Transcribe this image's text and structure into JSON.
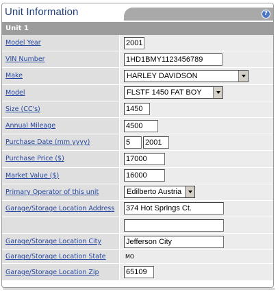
{
  "header": {
    "title": "Unit Information",
    "help_icon": "?"
  },
  "unit": {
    "label": "Unit 1"
  },
  "fields": {
    "model_year": {
      "label": "Model Year",
      "value": "2001"
    },
    "vin": {
      "label": "VIN Number",
      "value": "1HD1BMY1123456789"
    },
    "make": {
      "label": "Make",
      "value": "HARLEY DAVIDSON"
    },
    "model": {
      "label": "Model",
      "value": "FLSTF 1450 FAT BOY"
    },
    "size": {
      "label": "Size (CC's)",
      "value": "1450"
    },
    "annual_mileage": {
      "label": "Annual Mileage",
      "value": "4500"
    },
    "purchase_date": {
      "label": "Purchase Date (mm yyyy)",
      "month": "5",
      "year": "2001"
    },
    "purchase_price": {
      "label": "Purchase Price ($)",
      "value": "17000"
    },
    "market_value": {
      "label": "Market Value ($)",
      "value": "16000"
    },
    "primary_operator": {
      "label": "Primary Operator of this unit",
      "value": "Edilberto Austria"
    },
    "address": {
      "label": "Garage/Storage Location Address",
      "value": "374 Hot Springs Ct.",
      "value2": ""
    },
    "city": {
      "label": "Garage/Storage Location City",
      "value": "Jefferson City"
    },
    "state": {
      "label": "Garage/Storage Location State",
      "value": "MO"
    },
    "zip": {
      "label": "Garage/Storage Location Zip",
      "value": "65109"
    }
  }
}
